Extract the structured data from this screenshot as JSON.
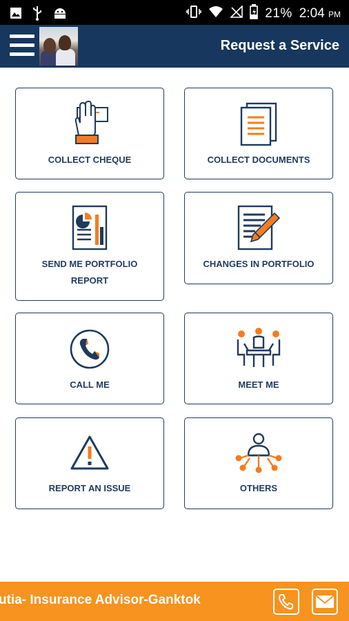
{
  "status_bar": {
    "battery_percent": "21%",
    "time": "2:04",
    "ampm": "PM",
    "left_icons": [
      "image-icon",
      "usb-icon",
      "android-icon"
    ],
    "right_icons": [
      "vibrate-icon",
      "wifi-icon",
      "no-signal-icon",
      "battery-charging-icon"
    ]
  },
  "app_bar": {
    "title": "Request a Service",
    "menu_icon": "hamburger-menu-icon"
  },
  "services": [
    {
      "label": "COLLECT CHEQUE",
      "icon": "cheque-hand-icon"
    },
    {
      "label": "COLLECT DOCUMENTS",
      "icon": "documents-icon"
    },
    {
      "label_line1": "SEND ME PORTFOLIO",
      "label_line2": "REPORT",
      "icon": "portfolio-report-icon"
    },
    {
      "label": "CHANGES IN PORTFOLIO",
      "icon": "edit-document-icon"
    },
    {
      "label": "CALL ME",
      "icon": "phone-icon"
    },
    {
      "label": "MEET ME",
      "icon": "meeting-icon"
    },
    {
      "label": "REPORT AN ISSUE",
      "icon": "warning-icon"
    },
    {
      "label": "OTHERS",
      "icon": "network-person-icon"
    }
  ],
  "bottom_bar": {
    "text": "utia- Insurance Advisor-Ganktok",
    "call_icon": "phone-icon",
    "mail_icon": "mail-icon"
  },
  "colors": {
    "navy": "#17375e",
    "accent_orange": "#f7931e",
    "icon_orange": "#f47c20",
    "card_border": "#1f3a5c"
  }
}
